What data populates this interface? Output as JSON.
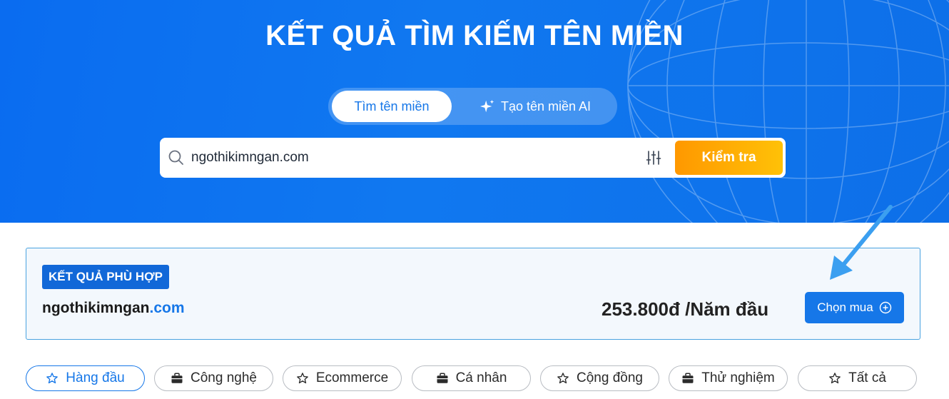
{
  "hero": {
    "title": "KẾT QUẢ TÌM KIẾM TÊN MIỀN",
    "modes": [
      {
        "label": "Tìm tên miền",
        "active": true,
        "icon": "none"
      },
      {
        "label": "Tạo tên miền AI",
        "active": false,
        "icon": "sparkle-icon"
      }
    ]
  },
  "search": {
    "value": "ngothikimngan.com",
    "button_label": "Kiểm tra"
  },
  "result": {
    "badge": "KẾT QUẢ PHÙ HỢP",
    "domain_name": "ngothikimngan",
    "domain_tld": ".com",
    "price": "253.800đ /Năm đầu",
    "buy_label": "Chọn mua"
  },
  "categories": [
    {
      "label": "Hàng đầu",
      "icon": "star-icon",
      "active": true
    },
    {
      "label": "Công nghệ",
      "icon": "briefcase-icon",
      "active": false
    },
    {
      "label": "Ecommerce",
      "icon": "star-icon",
      "active": false
    },
    {
      "label": "Cá nhân",
      "icon": "briefcase-icon",
      "active": false
    },
    {
      "label": "Cộng đồng",
      "icon": "star-icon",
      "active": false
    },
    {
      "label": "Thử nghiệm",
      "icon": "briefcase-icon",
      "active": false
    },
    {
      "label": "Tất cả",
      "icon": "star-icon",
      "active": false
    }
  ],
  "colors": {
    "primary": "#1677e8",
    "hero_bg": "#0a6cf0",
    "check_button": "#ff9800",
    "badge_bg": "#1168d8",
    "card_border": "#4aa3e0"
  }
}
